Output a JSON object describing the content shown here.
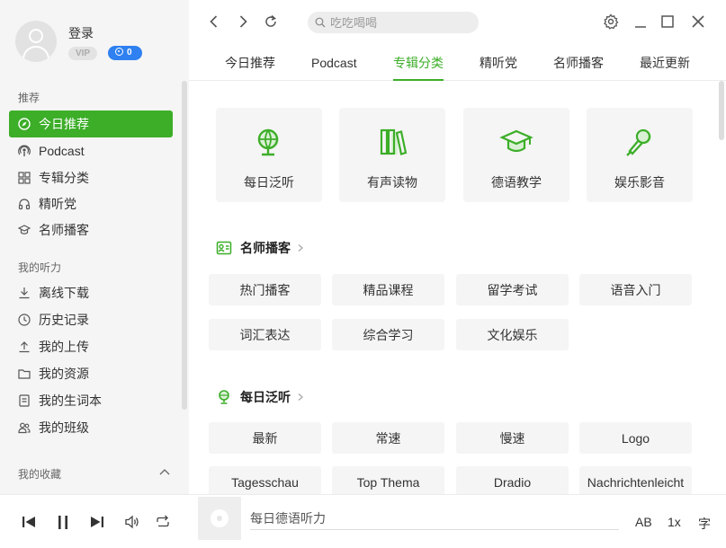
{
  "user": {
    "login_label": "登录",
    "vip_label": "VIP",
    "coins": "0"
  },
  "sidebar": {
    "section_recommend": "推荐",
    "recommend_items": [
      {
        "label": "今日推荐",
        "icon": "compass-icon",
        "active": true
      },
      {
        "label": "Podcast",
        "icon": "podcast-icon"
      },
      {
        "label": "专辑分类",
        "icon": "grid-icon"
      },
      {
        "label": "精听党",
        "icon": "headphones-icon"
      },
      {
        "label": "名师播客",
        "icon": "graduation-cap-icon"
      }
    ],
    "section_mine": "我的听力",
    "mine_items": [
      {
        "label": "离线下载",
        "icon": "download-icon"
      },
      {
        "label": "历史记录",
        "icon": "clock-icon"
      },
      {
        "label": "我的上传",
        "icon": "upload-icon"
      },
      {
        "label": "我的资源",
        "icon": "folder-icon"
      },
      {
        "label": "我的生词本",
        "icon": "notebook-icon"
      },
      {
        "label": "我的班级",
        "icon": "group-icon"
      }
    ],
    "section_favorites": "我的收藏"
  },
  "header": {
    "search_placeholder": "吃吃喝喝",
    "tabs": [
      {
        "label": "今日推荐"
      },
      {
        "label": "Podcast"
      },
      {
        "label": "专辑分类",
        "active": true
      },
      {
        "label": "精听党"
      },
      {
        "label": "名师播客"
      },
      {
        "label": "最近更新"
      }
    ]
  },
  "categories": [
    {
      "label": "每日泛听",
      "icon": "globe-icon"
    },
    {
      "label": "有声读物",
      "icon": "books-icon"
    },
    {
      "label": "德语教学",
      "icon": "graduation-cap-icon"
    },
    {
      "label": "娱乐影音",
      "icon": "microphone-icon"
    }
  ],
  "sections": [
    {
      "title": "名师播客",
      "icon": "teacher-card-icon",
      "items": [
        "热门播客",
        "精品课程",
        "留学考试",
        "语音入门",
        "词汇表达",
        "综合学习",
        "文化娱乐"
      ]
    },
    {
      "title": "每日泛听",
      "icon": "globe-icon",
      "items": [
        "最新",
        "常速",
        "慢速",
        "Logo",
        "Tagesschau",
        "Top Thema",
        "Dradio",
        "Nachrichtenleicht"
      ]
    }
  ],
  "player": {
    "track_title": "每日德语听力",
    "ab_label": "AB",
    "speed_label": "1x",
    "subtitle_label": "字"
  },
  "colors": {
    "accent": "#3cae28",
    "badge_blue": "#2f80f0",
    "sidebar_bg": "#f5f5f5"
  }
}
